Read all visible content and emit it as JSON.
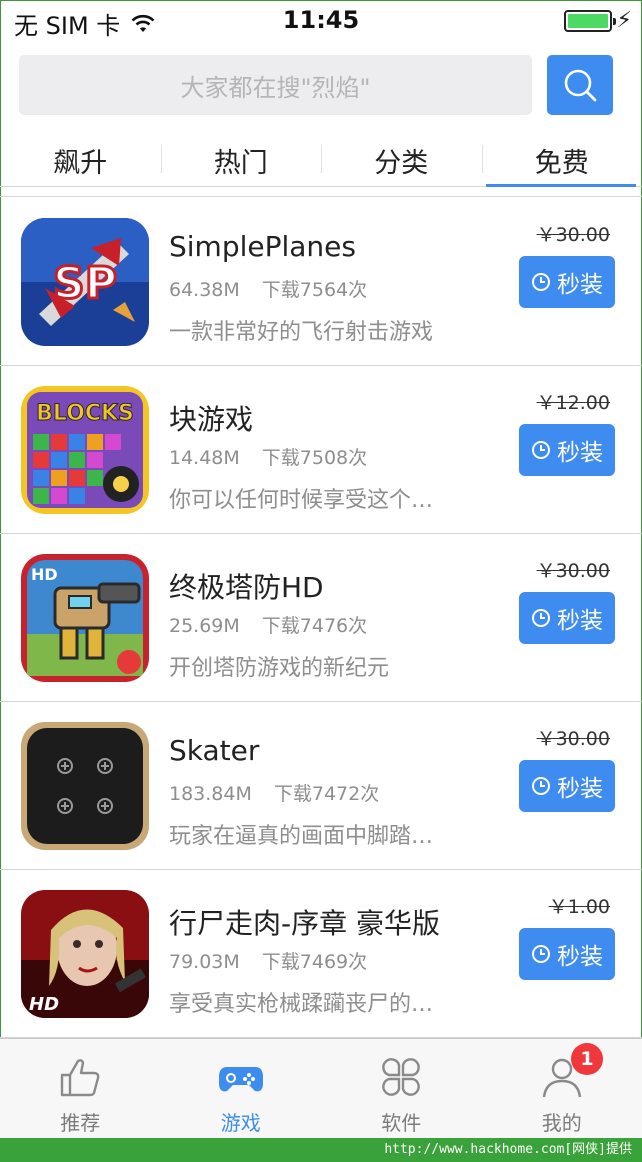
{
  "status_bar": {
    "carrier": "无 SIM 卡",
    "time": "11:45",
    "battery_level": 1.0
  },
  "search": {
    "placeholder": "大家都在搜\"烈焰\""
  },
  "tabs": [
    {
      "label": "飙升",
      "active": false
    },
    {
      "label": "热门",
      "active": false
    },
    {
      "label": "分类",
      "active": false
    },
    {
      "label": "免费",
      "active": true
    }
  ],
  "apps": [
    {
      "name": "SimplePlanes",
      "size": "64.38M",
      "downloads": "下载7564次",
      "desc": "一款非常好的飞行射击游戏",
      "price": "￥30.00",
      "button": "秒装",
      "icon": "simpleplanes-icon"
    },
    {
      "name": "块游戏",
      "size": "14.48M",
      "downloads": "下载7508次",
      "desc": "你可以任何时候享受这个…",
      "price": "￥12.00",
      "button": "秒装",
      "icon": "blocks-icon"
    },
    {
      "name": "终极塔防HD",
      "size": "25.69M",
      "downloads": "下载7476次",
      "desc": "开创塔防游戏的新纪元",
      "price": "￥30.00",
      "button": "秒装",
      "icon": "tower-defense-icon"
    },
    {
      "name": "Skater",
      "size": "183.84M",
      "downloads": "下载7472次",
      "desc": "玩家在逼真的画面中脚踏…",
      "price": "￥30.00",
      "button": "秒装",
      "icon": "skater-icon"
    },
    {
      "name": "行尸走肉-序章 豪华版",
      "size": "79.03M",
      "downloads": "下载7469次",
      "desc": "享受真实枪械蹂躏丧尸的…",
      "price": "￥1.00",
      "button": "秒装",
      "icon": "walking-dead-icon"
    }
  ],
  "tabbar": [
    {
      "label": "推荐",
      "icon": "thumbs-up-icon",
      "active": false
    },
    {
      "label": "游戏",
      "icon": "gamepad-icon",
      "active": true
    },
    {
      "label": "软件",
      "icon": "apps-grid-icon",
      "active": false
    },
    {
      "label": "我的",
      "icon": "user-icon",
      "active": false
    }
  ],
  "badge": "1",
  "hd_label": "HD",
  "blocks_label": "BLOCKS",
  "sp_label": "SP",
  "watermark": "http://www.hackhome.com[网侠]提供",
  "colors": {
    "accent": "#3f8cf0",
    "badge": "#f0383c",
    "watermark_bg": "#3aa23a"
  }
}
